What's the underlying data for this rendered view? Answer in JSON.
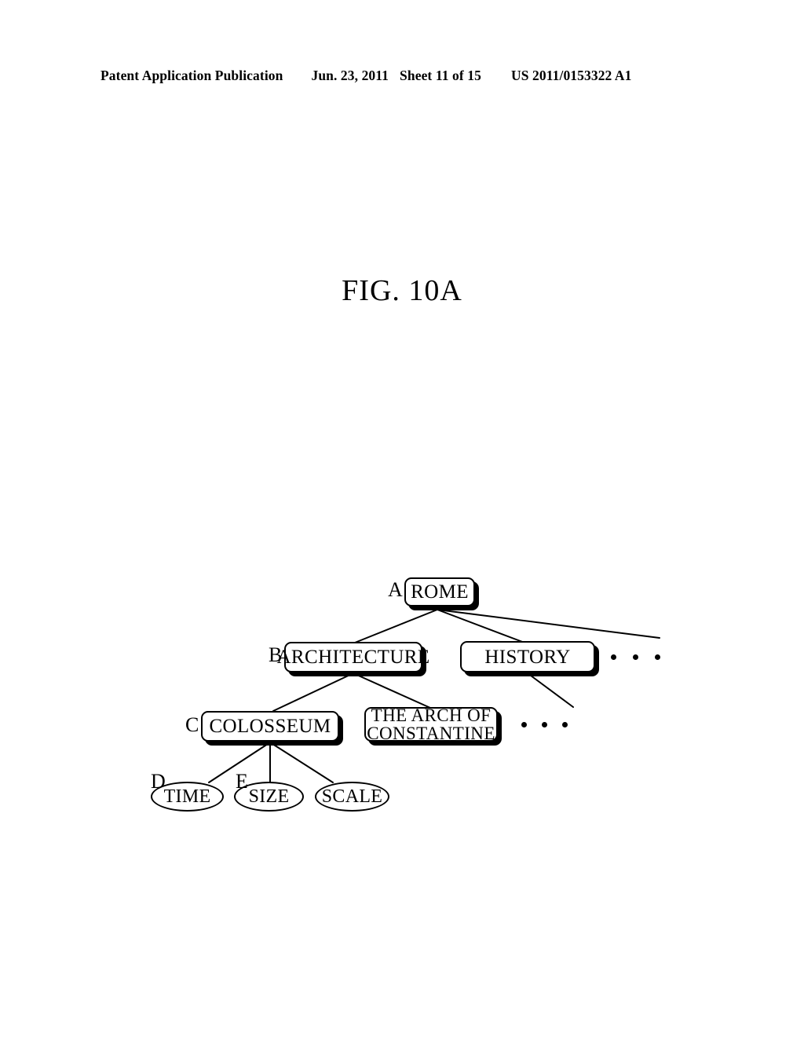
{
  "header": {
    "publication": "Patent Application Publication",
    "date": "Jun. 23, 2011",
    "sheet": "Sheet 11 of 15",
    "number": "US 2011/0153322 A1"
  },
  "figure": {
    "title": "FIG. 10A"
  },
  "diagram": {
    "type": "tree",
    "nodes": [
      {
        "id": "rome",
        "label": "ROME",
        "shape": "rounded-box",
        "ref": "A"
      },
      {
        "id": "architecture",
        "label": "ARCHITECTURE",
        "shape": "rounded-box",
        "ref": "B"
      },
      {
        "id": "history",
        "label": "HISTORY",
        "shape": "rounded-box",
        "ref": ""
      },
      {
        "id": "colosseum",
        "label": "COLOSSEUM",
        "shape": "rounded-box",
        "ref": "C"
      },
      {
        "id": "arch_line1",
        "label": "THE ARCH OF",
        "shape": "rounded-box",
        "ref": ""
      },
      {
        "id": "arch_line2",
        "label": "CONSTANTINE",
        "shape": "rounded-box",
        "ref": ""
      },
      {
        "id": "time",
        "label": "TIME",
        "shape": "ellipse",
        "ref": "D"
      },
      {
        "id": "size",
        "label": "SIZE",
        "shape": "ellipse",
        "ref": "E"
      },
      {
        "id": "scale",
        "label": "SCALE",
        "shape": "ellipse",
        "ref": ""
      }
    ],
    "edges": [
      {
        "from": "rome",
        "to": "architecture"
      },
      {
        "from": "rome",
        "to": "history"
      },
      {
        "from": "rome",
        "to": "more-top"
      },
      {
        "from": "architecture",
        "to": "colosseum"
      },
      {
        "from": "architecture",
        "to": "arch-of-constantine"
      },
      {
        "from": "history",
        "to": "more-history"
      },
      {
        "from": "colosseum",
        "to": "time"
      },
      {
        "from": "colosseum",
        "to": "size"
      },
      {
        "from": "colosseum",
        "to": "scale"
      }
    ],
    "ellipses": [
      {
        "id": "dots-top",
        "glyph": "• • •"
      },
      {
        "id": "dots-history",
        "glyph": "• • •"
      }
    ]
  }
}
